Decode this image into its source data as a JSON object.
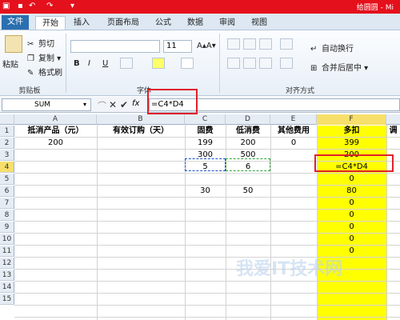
{
  "window": {
    "title": "给圆圆 - Mi"
  },
  "quick_access": {
    "undo": "↶",
    "redo": "↷"
  },
  "tabs": [
    "文件",
    "开始",
    "插入",
    "页面布局",
    "公式",
    "数据",
    "审阅",
    "视图"
  ],
  "clipboard": {
    "paste": "粘贴",
    "cut": "剪切",
    "copy": "复制",
    "format_painter": "格式刷",
    "label": "剪贴板"
  },
  "font_group": {
    "size": "11",
    "bold": "B",
    "italic": "I",
    "underline": "U",
    "label": "字体"
  },
  "align_group": {
    "wrap": "自动换行",
    "merge": "合并后居中",
    "label": "对齐方式"
  },
  "formula_bar": {
    "name_box": "SUM",
    "fx": "fx",
    "formula": "=C4*D4"
  },
  "columns": [
    "A",
    "B",
    "C",
    "D",
    "E",
    "F"
  ],
  "rows": [
    "1",
    "2",
    "3",
    "4",
    "5",
    "6",
    "7",
    "8",
    "9",
    "10",
    "11",
    "12",
    "13",
    "14",
    "15"
  ],
  "cells": {
    "A1": "抵消产品（元）",
    "B1": "有效订购（天）",
    "C1": "固费",
    "D1": "低消费",
    "E1": "其他费用",
    "F1": "多扣",
    "G1": "调",
    "A2": "200",
    "C2": "199",
    "D2": "200",
    "E2": "0",
    "F2": "399",
    "C3": "300",
    "D3": "500",
    "F3": "200",
    "C4": "5",
    "D4": "6",
    "F4": "=C4*D4",
    "F5": "0",
    "C6": "30",
    "D6": "50",
    "F6": "80",
    "F7": "0",
    "F8": "0",
    "F9": "0",
    "F10": "0",
    "F11": "0"
  },
  "watermark": "我爱IT技术网",
  "colors": {
    "title_red": "#e4101c",
    "highlight": "#ffff00",
    "callout": "#e0202a"
  }
}
